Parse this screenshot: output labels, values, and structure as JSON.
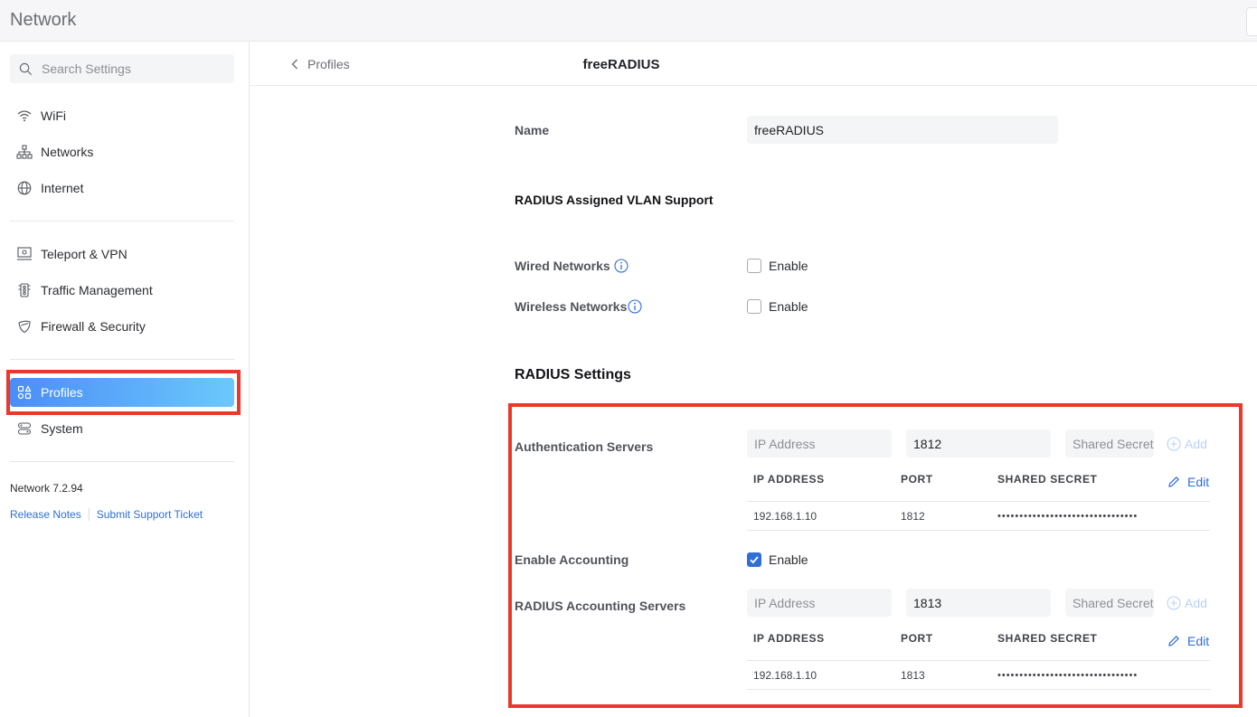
{
  "app": {
    "title": "Network"
  },
  "sidebar": {
    "search_placeholder": "Search Settings",
    "items": [
      {
        "label": "WiFi",
        "icon": "wifi-icon"
      },
      {
        "label": "Networks",
        "icon": "networks-icon"
      },
      {
        "label": "Internet",
        "icon": "globe-icon"
      },
      {
        "label": "Teleport & VPN",
        "icon": "teleport-icon"
      },
      {
        "label": "Traffic Management",
        "icon": "traffic-icon"
      },
      {
        "label": "Firewall & Security",
        "icon": "shield-icon"
      },
      {
        "label": "Profiles",
        "icon": "profiles-icon",
        "active": true
      },
      {
        "label": "System",
        "icon": "system-icon"
      }
    ],
    "version": "Network 7.2.94",
    "release_notes": "Release Notes",
    "support_ticket": "Submit Support Ticket"
  },
  "header": {
    "back_label": "Profiles",
    "title": "freeRADIUS"
  },
  "form": {
    "name_label": "Name",
    "name_value": "freeRADIUS",
    "vlan_title": "RADIUS Assigned VLAN Support",
    "wired_label": "Wired Networks",
    "wireless_label": "Wireless Networks",
    "enable_label": "Enable",
    "radius_title": "RADIUS Settings",
    "auth_label": "Authentication Servers",
    "accounting_enable_label": "Enable Accounting",
    "accounting_label": "RADIUS Accounting Servers",
    "ip_placeholder": "IP Address",
    "secret_placeholder": "Shared Secret",
    "auth_port": "1812",
    "acct_port": "1813",
    "add_label": "Add",
    "edit_label": "Edit",
    "col_ip": "IP ADDRESS",
    "col_port": "PORT",
    "col_secret": "SHARED SECRET",
    "auth_row": {
      "ip": "192.168.1.10",
      "port": "1812",
      "secret": "••••••••••••••••••••••••••••••••"
    },
    "acct_row": {
      "ip": "192.168.1.10",
      "port": "1813",
      "secret": "••••••••••••••••••••••••••••••••"
    },
    "wired_enabled": false,
    "wireless_enabled": false,
    "accounting_enabled": true
  },
  "colors": {
    "accent": "#2f6fd6",
    "highlight": "#e8392b"
  }
}
